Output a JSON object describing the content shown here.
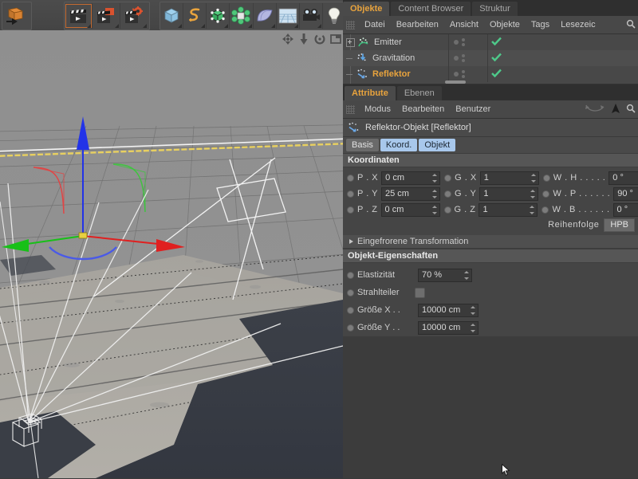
{
  "toolbar": {
    "groups": [
      {
        "name": "transform-group",
        "buttons": [
          {
            "icon": "orange-cube-arrow-icon",
            "label": "Undo/Transform",
            "selected": false,
            "corner": false
          }
        ]
      },
      {
        "name": "animation-group",
        "buttons": [
          {
            "icon": "clapperboard-play-icon",
            "label": "Animation abspielen",
            "selected": true,
            "corner": true
          },
          {
            "icon": "clapperboard-keyframe-icon",
            "label": "Keyframe aufzeichnen",
            "selected": false,
            "corner": true
          },
          {
            "icon": "clapperboard-settings-icon",
            "label": "Animationseinstellungen",
            "selected": false,
            "corner": true
          }
        ]
      },
      {
        "name": "object-group",
        "buttons": [
          {
            "icon": "cube-primitive-icon",
            "label": "Grundobjekte",
            "selected": false,
            "corner": true
          },
          {
            "icon": "spline-icon",
            "label": "Spline",
            "selected": false,
            "corner": true
          },
          {
            "icon": "nurbs-icon",
            "label": "NURBS",
            "selected": false,
            "corner": true
          },
          {
            "icon": "array-icon",
            "label": "Modeling-Objekte",
            "selected": false,
            "corner": true
          },
          {
            "icon": "deformer-icon",
            "label": "Deformer",
            "selected": false,
            "corner": true
          },
          {
            "icon": "floor-environment-icon",
            "label": "Szene",
            "selected": false,
            "corner": true
          },
          {
            "icon": "camera-icon",
            "label": "Kamera",
            "selected": false,
            "corner": true
          },
          {
            "icon": "light-bulb-icon",
            "label": "Licht",
            "selected": false,
            "corner": false
          }
        ]
      }
    ]
  },
  "viewport": {
    "nav_icons": [
      "move-view-icon",
      "dolly-view-icon",
      "rotate-view-icon",
      "maximize-view-icon"
    ],
    "background_color": "#8e8e8e",
    "axis": {
      "x_color": "#e02020",
      "y_color": "#2030e0",
      "z_color": "#18c018"
    },
    "horizon_line_color": "#e8d060",
    "wireframe_color": "#f0f0f0"
  },
  "object_manager": {
    "tabs": [
      {
        "label": "Objekte",
        "active": true
      },
      {
        "label": "Content Browser",
        "active": false
      },
      {
        "label": "Struktur",
        "active": false
      }
    ],
    "menu": [
      "Datei",
      "Bearbeiten",
      "Ansicht",
      "Objekte",
      "Tags",
      "Lesezeic"
    ],
    "menu_icons": [
      "search-icon"
    ],
    "rows": [
      {
        "name": "Emitter",
        "icon": "particle-emitter-icon",
        "selected": false,
        "expandable": true,
        "tag": "check-tag-icon"
      },
      {
        "name": "Gravitation",
        "icon": "gravity-field-icon",
        "selected": false,
        "expandable": false,
        "tag": "check-tag-icon"
      },
      {
        "name": "Reflektor",
        "icon": "reflector-field-icon",
        "selected": true,
        "expandable": false,
        "tag": "check-tag-icon"
      }
    ]
  },
  "attribute_manager": {
    "tabs": [
      {
        "label": "Attribute",
        "active": true
      },
      {
        "label": "Ebenen",
        "active": false
      }
    ],
    "menu": [
      "Modus",
      "Bearbeiten",
      "Benutzer"
    ],
    "menu_icons": [
      "undo-curve-icon",
      "pointer-arrow-icon",
      "search-icon"
    ],
    "object_title": "Reflektor-Objekt [Reflektor]",
    "object_icon": "reflector-field-icon",
    "subtabs": [
      {
        "label": "Basis",
        "active": false
      },
      {
        "label": "Koord.",
        "active": true
      },
      {
        "label": "Objekt",
        "active": true
      }
    ],
    "coordinates": {
      "section_title": "Koordinaten",
      "rows": [
        {
          "p_label": "P . X",
          "p_value": "0 cm",
          "g_label": "G . X",
          "g_value": "1",
          "w_label": "W . H . . . . .",
          "w_value": "0 °"
        },
        {
          "p_label": "P . Y",
          "p_value": "25 cm",
          "g_label": "G . Y",
          "g_value": "1",
          "w_label": "W . P . . . . . .",
          "w_value": "90 °"
        },
        {
          "p_label": "P . Z",
          "p_value": "0 cm",
          "g_label": "G . Z",
          "g_value": "1",
          "w_label": "W . B . . . . . .",
          "w_value": "0 °"
        }
      ],
      "order_label": "Reihenfolge",
      "order_value": "HPB"
    },
    "frozen_transform_label": "Eingefrorene Transformation",
    "object_properties": {
      "section_title": "Objekt-Eigenschaften",
      "rows": [
        {
          "label": "Elastizität",
          "type": "field",
          "value": "70 %"
        },
        {
          "label": "Strahlteiler",
          "type": "checkbox",
          "value": false
        },
        {
          "label": "Größe X . .",
          "type": "field",
          "value": "10000 cm"
        },
        {
          "label": "Größe Y . .",
          "type": "field",
          "value": "10000 cm"
        }
      ]
    }
  },
  "colors": {
    "accent_orange": "#e8a33d",
    "tab_active_blue": "#a8c8ec",
    "panel_bg": "#454545",
    "menubar_bg": "#484848",
    "section_bg": "#565656",
    "tag_green": "#4ec98a"
  }
}
